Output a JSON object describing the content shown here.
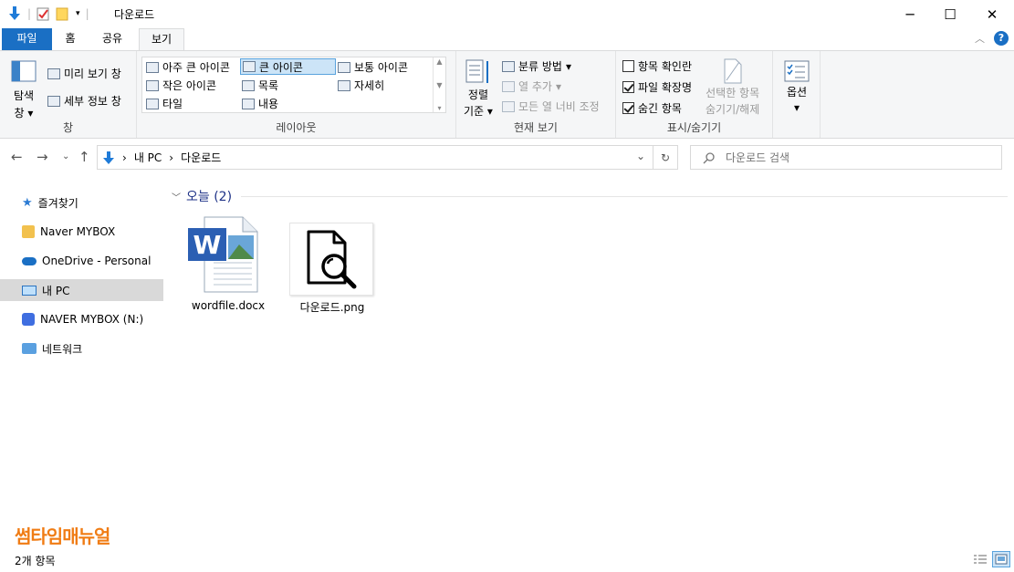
{
  "window": {
    "title": "다운로드",
    "minimize": "─",
    "maximize": "☐",
    "close": "✕"
  },
  "ribbon_tabs": [
    "파일",
    "홈",
    "공유",
    "보기"
  ],
  "ribbon": {
    "pane": {
      "nav_pane_line1": "탐색",
      "nav_pane_line2": "창",
      "preview": "미리 보기 창",
      "details": "세부 정보 창",
      "label": "창"
    },
    "layout": {
      "items": [
        "아주 큰 아이콘",
        "큰 아이콘",
        "보통 아이콘",
        "작은 아이콘",
        "목록",
        "자세히",
        "타일",
        "내용"
      ],
      "selected": "큰 아이콘",
      "label": "레이아웃"
    },
    "current_view": {
      "sort_line1": "정렬",
      "sort_line2": "기준",
      "group_by": "분류 방법",
      "add_columns": "열 추가",
      "size_all": "모든 열 너비 조정",
      "label": "현재 보기"
    },
    "show_hide": {
      "item_checkboxes": "항목 확인란",
      "file_extensions": "파일 확장명",
      "hidden_items": "숨긴 항목",
      "hide_selected_line1": "선택한 항목",
      "hide_selected_line2": "숨기기/해제",
      "label": "표시/숨기기",
      "checks": {
        "item_checkboxes": false,
        "file_extensions": true,
        "hidden_items": true
      }
    },
    "options": {
      "label": "옵션"
    }
  },
  "address": {
    "crumb_pc": "내 PC",
    "crumb_folder": "다운로드",
    "separator": "›"
  },
  "search": {
    "placeholder": "다운로드 검색"
  },
  "nav_pane": {
    "items": [
      "즐겨찾기",
      "Naver MYBOX",
      "OneDrive - Personal",
      "내 PC",
      "NAVER MYBOX (N:)",
      "네트워크"
    ],
    "selected": "내 PC"
  },
  "content": {
    "group_title": "오늘 (2)",
    "files": [
      "wordfile.docx",
      "다운로드.png"
    ]
  },
  "brand": "썸타임매뉴얼",
  "status": {
    "item_count": "2개 항목"
  },
  "colors": {
    "accent": "#1a6fc4",
    "brand": "#f07c14",
    "group_head": "#1e3287",
    "selected_nav": "#d9d9d9"
  }
}
